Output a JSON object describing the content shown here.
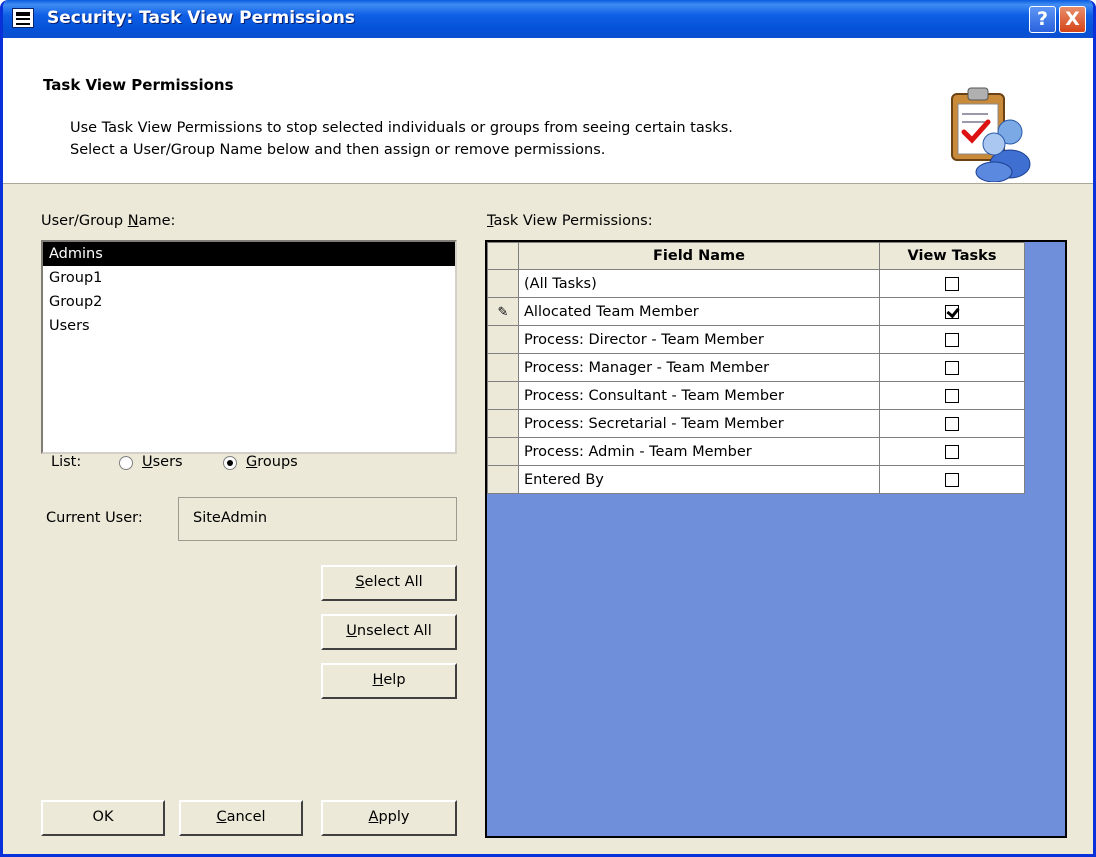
{
  "window": {
    "title": "Security: Task View Permissions",
    "help_btn": "?",
    "close_btn": "X",
    "colors": {
      "titlebar": "#0453d8",
      "face": "#ece9d8",
      "grid_bg": "#6f8fdb"
    }
  },
  "header": {
    "title": "Task View Permissions",
    "line1": "Use Task View Permissions to stop selected individuals or groups from seeing certain tasks.",
    "line2": "Select a User/Group Name below and then assign or remove permissions.",
    "icon": "security-permissions-icon"
  },
  "left": {
    "user_group_label_pre": "User/Group ",
    "user_group_label_key": "N",
    "user_group_label_post": "ame:",
    "list_items": [
      {
        "label": "Admins",
        "selected": true
      },
      {
        "label": "Group1",
        "selected": false
      },
      {
        "label": "Group2",
        "selected": false
      },
      {
        "label": "Users",
        "selected": false
      }
    ],
    "list_label": "List:",
    "radio_users_key": "U",
    "radio_users_rest": "sers",
    "radio_users_checked": false,
    "radio_groups_key": "G",
    "radio_groups_rest": "roups",
    "radio_groups_checked": true,
    "current_user_label": "Current User:",
    "current_user_value": "SiteAdmin"
  },
  "buttons": {
    "select_all_key": "S",
    "select_all_rest": "elect All",
    "unselect_all_key": "U",
    "unselect_all_rest": "nselect All",
    "help_key": "H",
    "help_rest": "elp",
    "ok": "OK",
    "cancel_key": "C",
    "cancel_rest": "ancel",
    "apply_key": "A",
    "apply_rest": "pply"
  },
  "grid": {
    "label_key": "T",
    "label_rest": "ask View Permissions:",
    "col_field": "Field Name",
    "col_view": "View Tasks",
    "rows": [
      {
        "field": "(All Tasks)",
        "view": false,
        "editing": false
      },
      {
        "field": "Allocated Team Member",
        "view": true,
        "editing": true
      },
      {
        "field": "Process: Director - Team Member",
        "view": false,
        "editing": false
      },
      {
        "field": "Process: Manager - Team Member",
        "view": false,
        "editing": false
      },
      {
        "field": "Process: Consultant - Team Member",
        "view": false,
        "editing": false
      },
      {
        "field": "Process: Secretarial - Team Member",
        "view": false,
        "editing": false
      },
      {
        "field": "Process: Admin - Team Member",
        "view": false,
        "editing": false
      },
      {
        "field": "Entered By",
        "view": false,
        "editing": false
      }
    ]
  }
}
